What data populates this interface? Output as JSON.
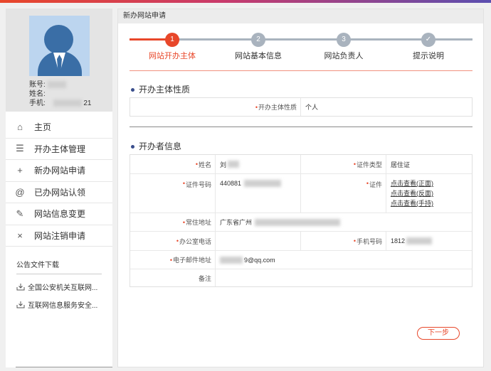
{
  "colors": {
    "accent": "#e8472a",
    "inactive_step": "#a9b3be",
    "bullet": "#3a4e8c"
  },
  "profile": {
    "account_label": "账号:",
    "name_label": "姓名:",
    "phone_label": "手机:",
    "phone_partial": "21"
  },
  "menu": {
    "items": [
      {
        "icon": "home-icon",
        "glyph": "⌂",
        "label": "主页"
      },
      {
        "icon": "list-icon",
        "glyph": "☰",
        "label": "开办主体管理"
      },
      {
        "icon": "plus-icon",
        "glyph": "+",
        "label": "新办网站申请"
      },
      {
        "icon": "at-icon",
        "glyph": "@",
        "label": "已办网站认领"
      },
      {
        "icon": "edit-icon",
        "glyph": "✎",
        "label": "网站信息变更"
      },
      {
        "icon": "close-icon",
        "glyph": "×",
        "label": "网站注销申请"
      }
    ]
  },
  "notice": {
    "title": "公告文件下载",
    "items": [
      "全国公安机关互联网...",
      "互联网信息服务安全..."
    ]
  },
  "main": {
    "header": "新办网站申请",
    "steps": [
      {
        "num": "1",
        "label": "网站开办主体",
        "active": true
      },
      {
        "num": "2",
        "label": "网站基本信息",
        "active": false
      },
      {
        "num": "3",
        "label": "网站负责人",
        "active": false
      },
      {
        "num": "✓",
        "label": "提示说明",
        "active": false
      }
    ],
    "section1": {
      "title": "开办主体性质",
      "label": "开办主体性质",
      "value": "个人"
    },
    "section2": {
      "title": "开办者信息",
      "name_label": "姓名",
      "name_value": "刘",
      "cert_type_label": "证件类型",
      "cert_type_value": "居住证",
      "cert_no_label": "证件号码",
      "cert_no_value": "440881",
      "cert_label": "证件",
      "cert_links": [
        "点击查看(正面)",
        "点击查看(反面)",
        "点击查看(手持)"
      ],
      "address_label": "常住地址",
      "address_value": "广东省广州",
      "office_phone_label": "办公室电话",
      "office_phone_value": "",
      "mobile_label": "手机号码",
      "mobile_value": "1812",
      "email_label": "电子邮件地址",
      "email_value": "9@qq.com",
      "remark_label": "备注",
      "remark_value": ""
    },
    "next_button": "下一步"
  }
}
